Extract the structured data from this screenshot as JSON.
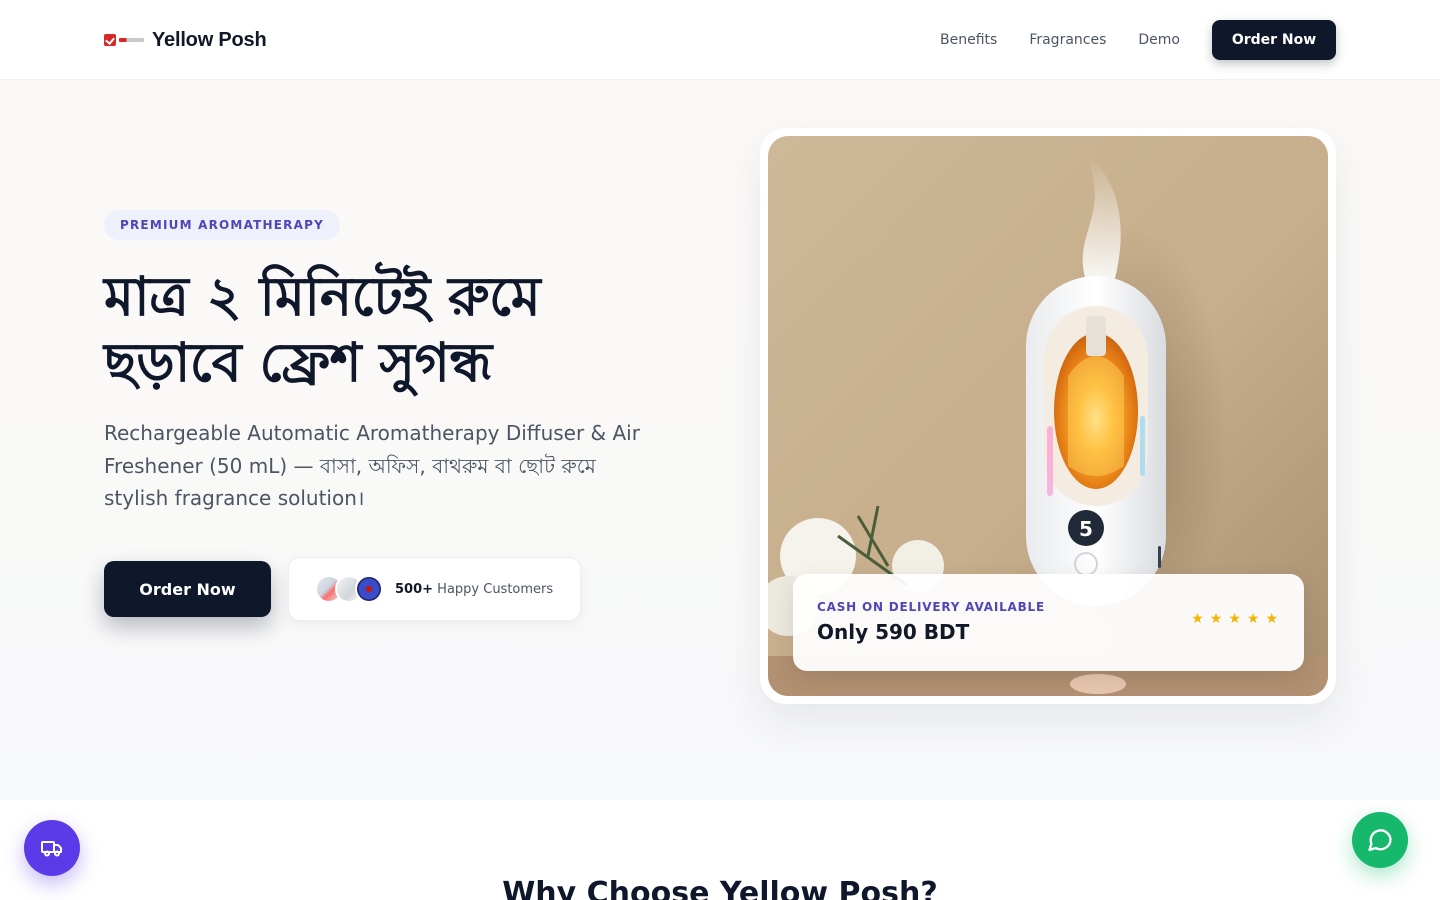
{
  "header": {
    "brand_name": "Yellow Posh",
    "nav": [
      "Benefits",
      "Fragrances",
      "Demo"
    ],
    "cta_label": "Order Now"
  },
  "hero": {
    "badge": "PREMIUM AROMATHERAPY",
    "headline": "মাত্র ২ মিনিটেই রুমে ছড়াবে ফ্রেশ সুগন্ধ",
    "subtext": "Rechargeable Automatic Aromatherapy Diffuser & Air Freshener (50 mL) — বাসা, অফিস, বাথরুম বা ছোট রুমে stylish fragrance solution।",
    "cta_label": "Order Now",
    "customers": {
      "count": "500+",
      "label": "Happy Customers"
    }
  },
  "product_card": {
    "label": "CASH ON DELIVERY AVAILABLE",
    "price": "Only 590 BDT",
    "rating_stars": 5,
    "display_digit": "5"
  },
  "next_section": {
    "title": "Why Choose Yellow Posh?"
  },
  "floating": {
    "left_icon": "truck-icon",
    "right_icon": "chat-bubble-icon"
  },
  "colors": {
    "primary_dark": "#0f172a",
    "accent_indigo": "#4f46b8",
    "star_gold": "#f5b400",
    "float_purple": "#5b3be8",
    "float_green": "#16b86b"
  }
}
